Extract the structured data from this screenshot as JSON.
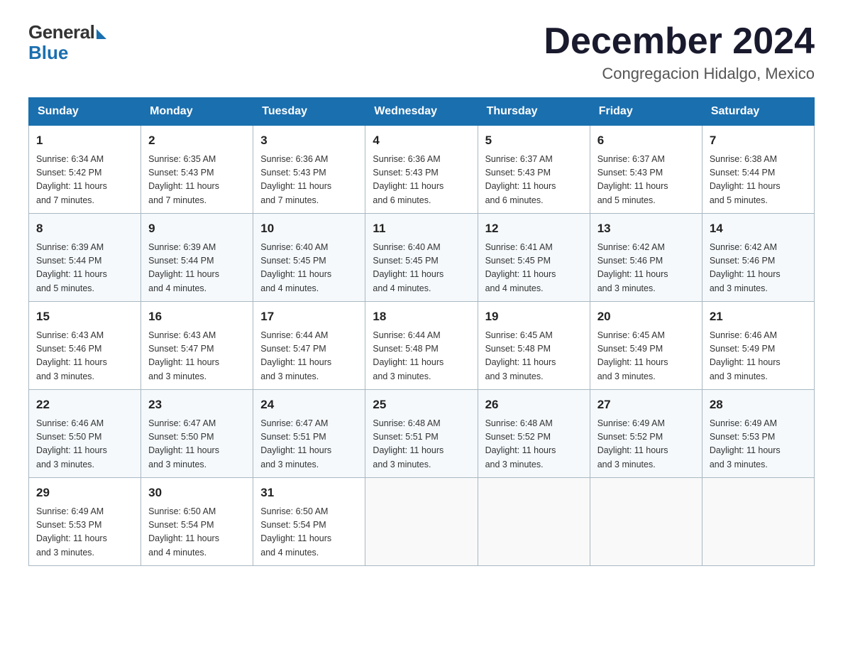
{
  "logo": {
    "general": "General",
    "blue": "Blue"
  },
  "header": {
    "month": "December 2024",
    "location": "Congregacion Hidalgo, Mexico"
  },
  "weekdays": [
    "Sunday",
    "Monday",
    "Tuesday",
    "Wednesday",
    "Thursday",
    "Friday",
    "Saturday"
  ],
  "weeks": [
    [
      {
        "day": "1",
        "sunrise": "6:34 AM",
        "sunset": "5:42 PM",
        "daylight": "11 hours and 7 minutes."
      },
      {
        "day": "2",
        "sunrise": "6:35 AM",
        "sunset": "5:43 PM",
        "daylight": "11 hours and 7 minutes."
      },
      {
        "day": "3",
        "sunrise": "6:36 AM",
        "sunset": "5:43 PM",
        "daylight": "11 hours and 7 minutes."
      },
      {
        "day": "4",
        "sunrise": "6:36 AM",
        "sunset": "5:43 PM",
        "daylight": "11 hours and 6 minutes."
      },
      {
        "day": "5",
        "sunrise": "6:37 AM",
        "sunset": "5:43 PM",
        "daylight": "11 hours and 6 minutes."
      },
      {
        "day": "6",
        "sunrise": "6:37 AM",
        "sunset": "5:43 PM",
        "daylight": "11 hours and 5 minutes."
      },
      {
        "day": "7",
        "sunrise": "6:38 AM",
        "sunset": "5:44 PM",
        "daylight": "11 hours and 5 minutes."
      }
    ],
    [
      {
        "day": "8",
        "sunrise": "6:39 AM",
        "sunset": "5:44 PM",
        "daylight": "11 hours and 5 minutes."
      },
      {
        "day": "9",
        "sunrise": "6:39 AM",
        "sunset": "5:44 PM",
        "daylight": "11 hours and 4 minutes."
      },
      {
        "day": "10",
        "sunrise": "6:40 AM",
        "sunset": "5:45 PM",
        "daylight": "11 hours and 4 minutes."
      },
      {
        "day": "11",
        "sunrise": "6:40 AM",
        "sunset": "5:45 PM",
        "daylight": "11 hours and 4 minutes."
      },
      {
        "day": "12",
        "sunrise": "6:41 AM",
        "sunset": "5:45 PM",
        "daylight": "11 hours and 4 minutes."
      },
      {
        "day": "13",
        "sunrise": "6:42 AM",
        "sunset": "5:46 PM",
        "daylight": "11 hours and 3 minutes."
      },
      {
        "day": "14",
        "sunrise": "6:42 AM",
        "sunset": "5:46 PM",
        "daylight": "11 hours and 3 minutes."
      }
    ],
    [
      {
        "day": "15",
        "sunrise": "6:43 AM",
        "sunset": "5:46 PM",
        "daylight": "11 hours and 3 minutes."
      },
      {
        "day": "16",
        "sunrise": "6:43 AM",
        "sunset": "5:47 PM",
        "daylight": "11 hours and 3 minutes."
      },
      {
        "day": "17",
        "sunrise": "6:44 AM",
        "sunset": "5:47 PM",
        "daylight": "11 hours and 3 minutes."
      },
      {
        "day": "18",
        "sunrise": "6:44 AM",
        "sunset": "5:48 PM",
        "daylight": "11 hours and 3 minutes."
      },
      {
        "day": "19",
        "sunrise": "6:45 AM",
        "sunset": "5:48 PM",
        "daylight": "11 hours and 3 minutes."
      },
      {
        "day": "20",
        "sunrise": "6:45 AM",
        "sunset": "5:49 PM",
        "daylight": "11 hours and 3 minutes."
      },
      {
        "day": "21",
        "sunrise": "6:46 AM",
        "sunset": "5:49 PM",
        "daylight": "11 hours and 3 minutes."
      }
    ],
    [
      {
        "day": "22",
        "sunrise": "6:46 AM",
        "sunset": "5:50 PM",
        "daylight": "11 hours and 3 minutes."
      },
      {
        "day": "23",
        "sunrise": "6:47 AM",
        "sunset": "5:50 PM",
        "daylight": "11 hours and 3 minutes."
      },
      {
        "day": "24",
        "sunrise": "6:47 AM",
        "sunset": "5:51 PM",
        "daylight": "11 hours and 3 minutes."
      },
      {
        "day": "25",
        "sunrise": "6:48 AM",
        "sunset": "5:51 PM",
        "daylight": "11 hours and 3 minutes."
      },
      {
        "day": "26",
        "sunrise": "6:48 AM",
        "sunset": "5:52 PM",
        "daylight": "11 hours and 3 minutes."
      },
      {
        "day": "27",
        "sunrise": "6:49 AM",
        "sunset": "5:52 PM",
        "daylight": "11 hours and 3 minutes."
      },
      {
        "day": "28",
        "sunrise": "6:49 AM",
        "sunset": "5:53 PM",
        "daylight": "11 hours and 3 minutes."
      }
    ],
    [
      {
        "day": "29",
        "sunrise": "6:49 AM",
        "sunset": "5:53 PM",
        "daylight": "11 hours and 3 minutes."
      },
      {
        "day": "30",
        "sunrise": "6:50 AM",
        "sunset": "5:54 PM",
        "daylight": "11 hours and 4 minutes."
      },
      {
        "day": "31",
        "sunrise": "6:50 AM",
        "sunset": "5:54 PM",
        "daylight": "11 hours and 4 minutes."
      },
      null,
      null,
      null,
      null
    ]
  ],
  "labels": {
    "sunrise": "Sunrise: ",
    "sunset": "Sunset: ",
    "daylight": "Daylight: "
  }
}
